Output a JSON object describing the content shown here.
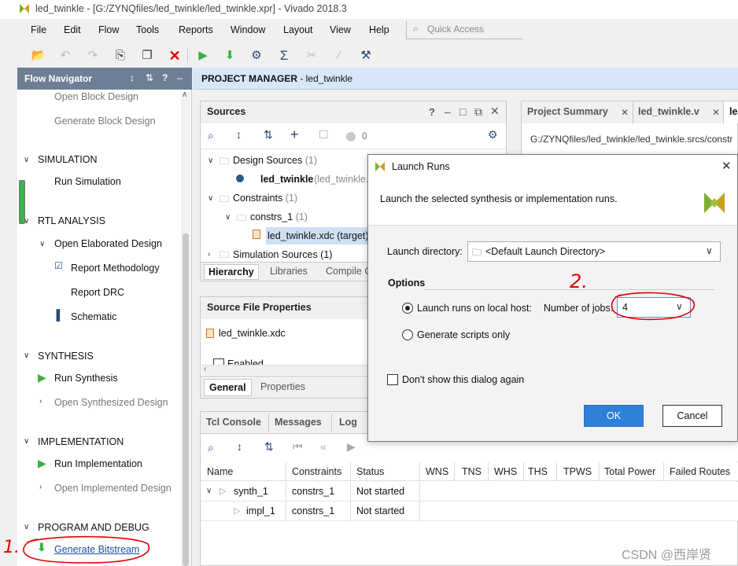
{
  "window": {
    "title": "led_twinkle - [G:/ZYNQfiles/led_twinkle/led_twinkle.xpr] - Vivado 2018.3"
  },
  "menu": [
    "File",
    "Edit",
    "Flow",
    "Tools",
    "Reports",
    "Window",
    "Layout",
    "View",
    "Help"
  ],
  "quick_access": {
    "placeholder": "Quick Access"
  },
  "flow_navigator": {
    "title": "Flow Navigator",
    "items": {
      "open_block_design": "Open Block Design",
      "generate_block_design": "Generate Block Design",
      "simulation": "SIMULATION",
      "run_simulation": "Run Simulation",
      "rtl_analysis": "RTL ANALYSIS",
      "open_elaborated_design": "Open Elaborated Design",
      "report_methodology": "Report Methodology",
      "report_drc": "Report DRC",
      "schematic": "Schematic",
      "synthesis": "SYNTHESIS",
      "run_synthesis": "Run Synthesis",
      "open_synthesized_design": "Open Synthesized Design",
      "implementation": "IMPLEMENTATION",
      "run_implementation": "Run Implementation",
      "open_implemented_design": "Open Implemented Design",
      "program_and_debug": "PROGRAM AND DEBUG",
      "generate_bitstream": "Generate Bitstream"
    }
  },
  "project_manager": {
    "label": "PROJECT MANAGER",
    "project": " - led_twinkle"
  },
  "sources": {
    "title": "Sources",
    "status_count": "0",
    "tree": {
      "design_sources": "Design Sources",
      "design_sources_count": "(1)",
      "led_twinkle": "led_twinkle",
      "led_twinkle_suffix": "(led_twinkle.",
      "constraints": "Constraints",
      "constraints_count": "(1)",
      "constrs_1": "constrs_1",
      "constrs_1_count": "(1)",
      "xdc_file": "led_twinkle.xdc (target)",
      "simulation_sources": "Simulation Sources (1)"
    },
    "tabs": [
      "Hierarchy",
      "Libraries",
      "Compile O"
    ]
  },
  "source_file_properties": {
    "title": "Source File Properties",
    "file": "led_twinkle.xdc",
    "enabled": "Enabled",
    "tabs": [
      "General",
      "Properties"
    ]
  },
  "editor": {
    "tabs": [
      "Project Summary",
      "led_twinkle.v",
      "le"
    ],
    "path": "G:/ZYNQfiles/led_twinkle/led_twinkle.srcs/constr"
  },
  "tcl": {
    "tabs": [
      "Tcl Console",
      "Messages",
      "Log"
    ],
    "columns": [
      "Name",
      "Constraints",
      "Status",
      "WNS",
      "TNS",
      "WHS",
      "THS",
      "TPWS",
      "Total Power",
      "Failed Routes"
    ],
    "rows": [
      {
        "name": "synth_1",
        "constraints": "constrs_1",
        "status": "Not started"
      },
      {
        "name": "impl_1",
        "constraints": "constrs_1",
        "status": "Not started"
      }
    ]
  },
  "dialog": {
    "title": "Launch Runs",
    "description": "Launch the selected synthesis or implementation runs.",
    "launch_directory_label": "Launch directory:",
    "launch_directory_value": "<Default Launch Directory>",
    "options_label": "Options",
    "local_host_label": "Launch runs on local host:",
    "jobs_label": "Number of jobs:",
    "jobs_value": "4",
    "scripts_only_label": "Generate scripts only",
    "dont_show_label": "Don't show this dialog again",
    "ok": "OK",
    "cancel": "Cancel"
  },
  "annotations": {
    "note_1": "1.",
    "note_2": "2."
  },
  "watermark": "CSDN @西岸贤",
  "colors": {
    "accent": "#2f6fb6",
    "header": "#6e7f95",
    "ok_button": "#2f80d8",
    "annotation": "#e00000",
    "run_green": "#3cb043"
  }
}
